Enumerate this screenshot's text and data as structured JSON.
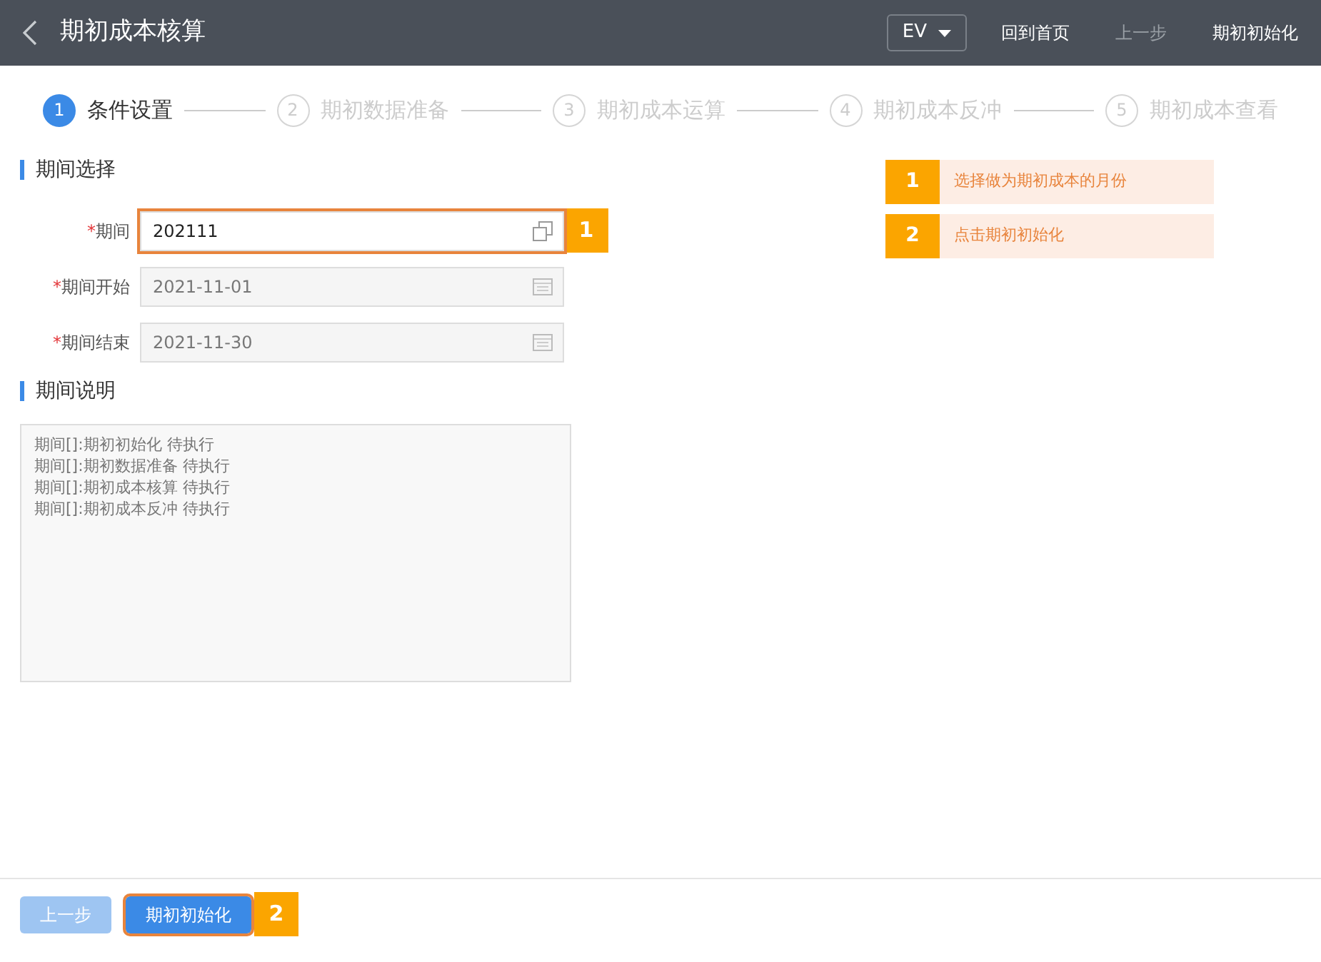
{
  "header": {
    "title": "期初成本核算",
    "dropdown": "EV",
    "actions": [
      {
        "label": "回到首页",
        "disabled": false
      },
      {
        "label": "上一步",
        "disabled": true
      },
      {
        "label": "期初初始化",
        "disabled": false
      }
    ]
  },
  "steps": [
    {
      "number": "1",
      "label": "条件设置",
      "selected": true
    },
    {
      "number": "2",
      "label": "期初数据准备",
      "selected": false
    },
    {
      "number": "3",
      "label": "期初成本运算",
      "selected": false
    },
    {
      "number": "4",
      "label": "期初成本反冲",
      "selected": false
    },
    {
      "number": "5",
      "label": "期初成本查看",
      "selected": false
    }
  ],
  "period_section": {
    "title": "期间选择",
    "fields": [
      {
        "required_mark": "*",
        "label": "期间",
        "value": "202111",
        "disabled": false,
        "kind": "lookup",
        "highlighted": true,
        "callout": "1"
      },
      {
        "required_mark": "*",
        "label": "期间开始",
        "value": "2021-11-01",
        "disabled": true,
        "kind": "date",
        "highlighted": false
      },
      {
        "required_mark": "*",
        "label": "期间结束",
        "value": "2021-11-30",
        "disabled": true,
        "kind": "date",
        "highlighted": false
      }
    ]
  },
  "description_section": {
    "title": "期间说明",
    "lines": [
      "期间[]:期初初始化 待执行",
      "期间[]:期初数据准备 待执行",
      "期间[]:期初成本核算 待执行",
      "期间[]:期初成本反冲 待执行"
    ]
  },
  "guide": [
    {
      "number": "1",
      "text": "选择做为期初成本的月份"
    },
    {
      "number": "2",
      "text": "点击期初初始化"
    }
  ],
  "footer": {
    "buttons": [
      {
        "label": "上一步",
        "disabled": true,
        "highlighted": false
      },
      {
        "label": "期初初始化",
        "disabled": false,
        "highlighted": true,
        "callout": "2"
      }
    ]
  }
}
